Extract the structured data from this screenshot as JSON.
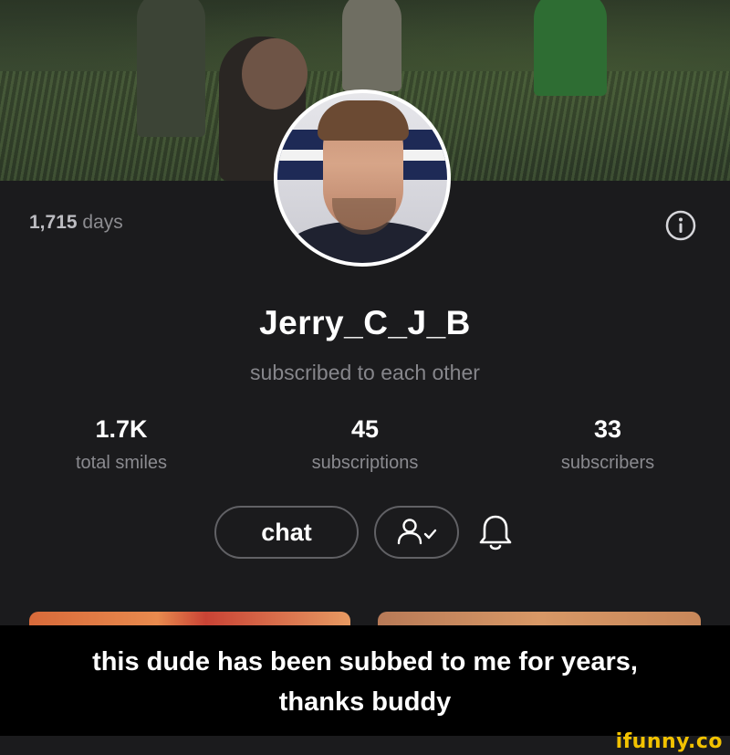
{
  "profile": {
    "days_count": "1,715",
    "days_unit": "days",
    "username": "Jerry_C_J_B",
    "relation": "subscribed to each other"
  },
  "stats": [
    {
      "value": "1.7K",
      "label": "total smiles"
    },
    {
      "value": "45",
      "label": "subscriptions"
    },
    {
      "value": "33",
      "label": "subscribers"
    }
  ],
  "actions": {
    "chat_label": "chat",
    "subscribe_icon": "user-check-icon",
    "bell_icon": "bell-icon",
    "info_icon": "info-icon"
  },
  "caption": {
    "line1": "this dude has been subbed to me for years,",
    "line2": "thanks buddy"
  },
  "watermark": "ifunny.co",
  "colors": {
    "background": "#1b1b1d",
    "watermark": "#f2c200"
  }
}
